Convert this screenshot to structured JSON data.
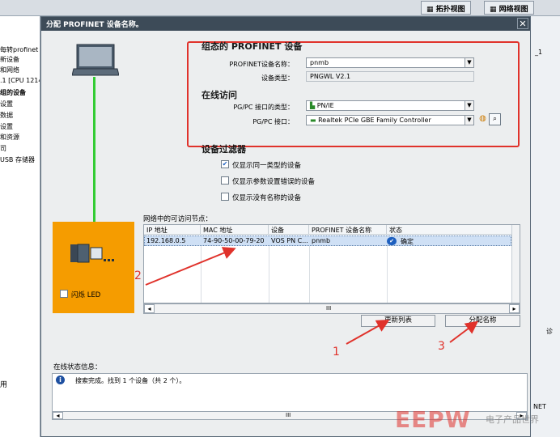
{
  "background_app": {
    "tabs": [
      "拓扑视图",
      "网络视图"
    ],
    "tree_items": [
      "每转profinet",
      "新设备",
      "和网络",
      ".1 [CPU 1214",
      "组的设备",
      "设置",
      "数据",
      "设置",
      "和资源",
      "司",
      "USB 存储器"
    ],
    "bottom_left_label": "用",
    "right_items": [
      "_1",
      "诊",
      "NET"
    ]
  },
  "dialog": {
    "title": "分配 PROFINET 设备名称。",
    "close": "✕",
    "configured_section": {
      "title": "组态的 PROFINET 设备",
      "device_name_label": "PROFINET设备名称：",
      "device_name_value": "pnmb",
      "device_type_label": "设备类型：",
      "device_type_value": "PNGWL V2.1"
    },
    "online_section": {
      "title": "在线访问",
      "pgpc_type_label": "PG/PC 接口的类型：",
      "pgpc_type_value": "PN/IE",
      "pgpc_interface_label": "PG/PC 接口：",
      "pgpc_interface_value": "Realtek PCIe GBE Family Controller"
    },
    "filter_section": {
      "title": "设备过滤器",
      "options": [
        {
          "label": "仅显示同一类型的设备",
          "checked": true
        },
        {
          "label": "仅显示参数设置错误的设备",
          "checked": false
        },
        {
          "label": "仅显示没有名称的设备",
          "checked": false
        }
      ]
    },
    "flash_led_label": "闪烁 LED",
    "table": {
      "caption": "网络中的可访问节点：",
      "headers": [
        "IP 地址",
        "MAC 地址",
        "设备",
        "PROFINET 设备名称",
        "状态"
      ],
      "rows": [
        {
          "ip": "192.168.0.5",
          "mac": "74-90-50-00-79-20",
          "device": "VOS PN C...",
          "name": "pnmb",
          "status": "确定"
        }
      ],
      "scroll_mid": "III"
    },
    "update_button": "更新列表",
    "assign_button": "分配名称",
    "status": {
      "label": "在线状态信息：",
      "message": "搜索完成。找到 1 个设备（共 2 个）。",
      "scroll_mid": "III"
    }
  },
  "annotations": [
    "1",
    "2",
    "3"
  ],
  "watermark": {
    "brand": "EEPW",
    "tagline": "电子产品世界"
  },
  "colors": {
    "highlight_red": "#e0322b",
    "device_panel": "#f59c00",
    "link_green": "#33cc33",
    "selection": "#cfe0f5"
  }
}
